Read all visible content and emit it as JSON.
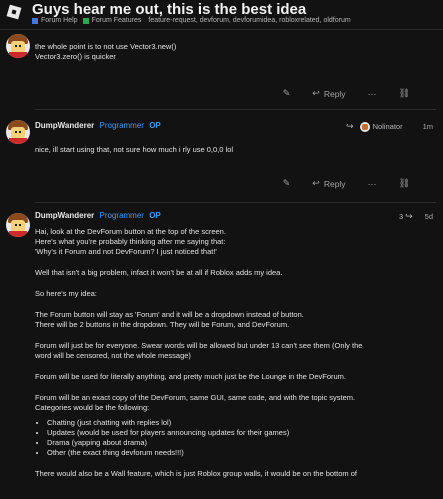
{
  "topic": {
    "title": "Guys hear me out, this is the best idea",
    "categories": [
      {
        "label": "Forum Help",
        "color": "#3d7be0"
      },
      {
        "label": "Forum Features",
        "color": "#2aa84f"
      }
    ],
    "tags": "feature-request, devforum, devforumidea, robloxrelated, oldforum"
  },
  "posts": [
    {
      "lines": [
        "the whole point is to not use Vector3.new()",
        "Vector3.zero() is quicker"
      ],
      "actions": {
        "reply": "Reply"
      }
    },
    {
      "author": "DumpWanderer",
      "role": "Programmer",
      "op": "OP",
      "reply_to": "Nolinator",
      "time": "1m",
      "text": "nice, ill start using that, not sure how much i rly use 0,0,0 lol",
      "actions": {
        "reply": "Reply"
      }
    },
    {
      "author": "DumpWanderer",
      "role": "Programmer",
      "op": "OP",
      "replies_count": "3",
      "time": "5d",
      "paragraphs": [
        [
          "Hai, look at the DevForum button at the top of the screen.",
          "Here's what you're probably thinking after me saying that:",
          "'Why's it Forum and not DevForum? I just noticed that!'"
        ],
        [
          "Well that isn't a big problem, infact it won't be at all if Roblox adds my idea."
        ],
        [
          "So here's my idea:"
        ],
        [
          "The Forum button will stay as 'Forum' and it will be a dropdown instead of button.",
          "There will be 2 buttons in the dropdown. They will be Forum, and DevForum."
        ],
        [
          "Forum will just be for everyone. Swear words will be allowed but under 13 can't see them (Only the",
          "word will be censored, not the whole message)"
        ],
        [
          "Forum will be used for literally anything, and pretty much just be the Lounge in the DevForum."
        ],
        [
          "Forum will be an exact copy of the DevForum, same GUI, same code, and with the topic system.",
          "Categories would be the following:"
        ]
      ],
      "list": [
        "Chatting (just chatting with replies lol)",
        "Updates (would be used for players announcing updates for their games)",
        "Drama (yapping about drama)",
        "Other (the exact thing devforum needs!!!)"
      ],
      "last": "There would also be a Wall feature, which is just Roblox group walls, it would be on the bottom of"
    }
  ]
}
